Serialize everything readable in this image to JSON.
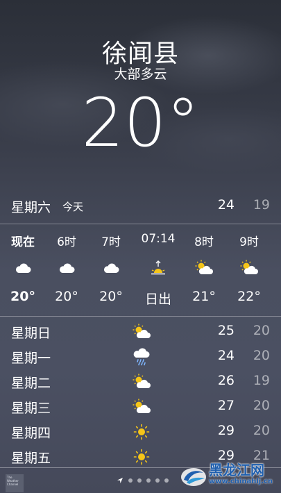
{
  "location": {
    "city": "徐闻县",
    "condition": "大部多云",
    "temperature": "20°"
  },
  "today": {
    "day": "星期六",
    "label": "今天",
    "high": "24",
    "low": "19"
  },
  "hourly": [
    {
      "time": "现在",
      "icon": "cloud-icon",
      "temp": "20°"
    },
    {
      "time": "6时",
      "icon": "cloud-icon",
      "temp": "20°"
    },
    {
      "time": "7时",
      "icon": "cloud-icon",
      "temp": "20°"
    },
    {
      "time": "07:14",
      "icon": "sunrise-icon",
      "temp": "日出"
    },
    {
      "time": "8时",
      "icon": "partly-sunny-icon",
      "temp": "21°"
    },
    {
      "time": "9时",
      "icon": "partly-sunny-icon",
      "temp": "22°"
    }
  ],
  "daily": [
    {
      "day": "星期日",
      "icon": "partly-sunny-icon",
      "high": "25",
      "low": "20"
    },
    {
      "day": "星期一",
      "icon": "rain-cloud-icon",
      "high": "24",
      "low": "20"
    },
    {
      "day": "星期二",
      "icon": "partly-sunny-icon",
      "high": "26",
      "low": "19"
    },
    {
      "day": "星期三",
      "icon": "partly-sunny-icon",
      "high": "27",
      "low": "20"
    },
    {
      "day": "星期四",
      "icon": "sun-icon",
      "high": "29",
      "low": "20"
    },
    {
      "day": "星期五",
      "icon": "sun-icon",
      "high": "29",
      "low": "21"
    }
  ],
  "footer": {
    "weather_channel_logo": "The Weather Channel",
    "watermark_title": "黑龙江网",
    "watermark_url": "www.chinahlj.cn"
  },
  "colors": {
    "sun": "#f5c518",
    "cloud": "#ffffff",
    "watermark": "#1f5fae"
  }
}
